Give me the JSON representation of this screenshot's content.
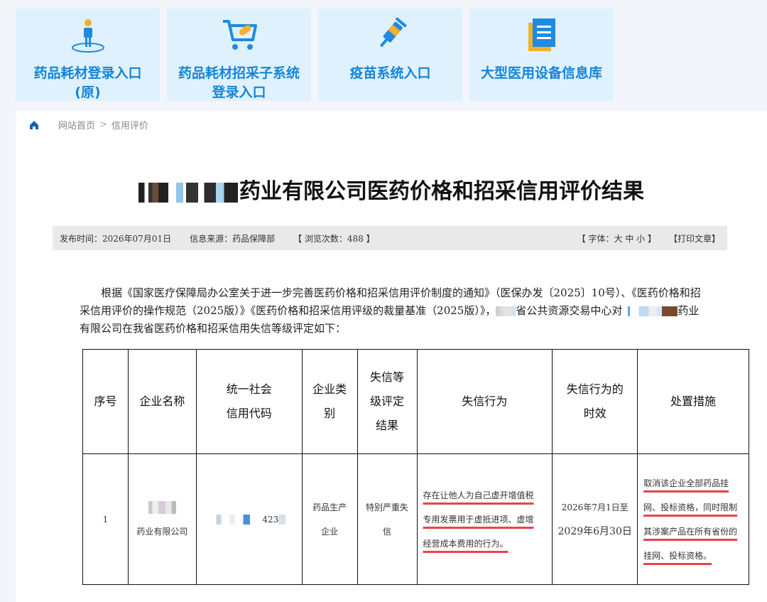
{
  "tiles": [
    {
      "label_line1": "药品耗材登录入口",
      "label_line2": "(原)",
      "icon": "person-pin-icon"
    },
    {
      "label_line1": "药品耗材招采子系统",
      "label_line2": "登录入口",
      "icon": "shopping-cart-pill-icon"
    },
    {
      "label_line1": "疫苗系统入口",
      "label_line2": "",
      "icon": "syringe-icon"
    },
    {
      "label_line1": "大型医用设备信息库",
      "label_line2": "",
      "icon": "document-list-icon"
    }
  ],
  "breadcrumb": {
    "home": "网站首页",
    "separator": ">",
    "current": "信用评价"
  },
  "article": {
    "title": "药业有限公司医药价格和招采信用评价结果",
    "meta": {
      "published": "发布时间：2026年07月01日",
      "source": "信息来源：药品保障部",
      "views": "【 浏览次数：488 】",
      "font_size": "【 字体：大 中 小 】",
      "print": "【打印文章】"
    },
    "para_part1": "根据《国家医疗保障局办公室关于进一步完善医药价格和招采信用评价制度的通知》（医保办发〔2025〕10号）、《医药价格和招采信用评价的操作规范（2025版）》《医药价格和招采信用评级的裁量基准（2025版）》，",
    "para_part2": "省公共资源交易中心对",
    "para_part3": "药业有限公司在我省医药价格和招采信用失信等级评定如下："
  },
  "table": {
    "headers": [
      "序号",
      "企业名称",
      "统一社会\n信用代码",
      "企业类\n别",
      "失信等\n级评定\n结果",
      "失信行为",
      "失信行为的\n时效",
      "处置措施"
    ],
    "row": {
      "index": "1",
      "company": "药业有限公司",
      "credit_code": "423",
      "category_line1": "药品生产",
      "category_line2": "企业",
      "rating_line1": "特别严重失",
      "rating_line2": "信",
      "behavior": [
        "存在让他人为自己虚开增值税",
        "专用发票用于虚抵进项、虚增",
        "经营成本费用的行为。"
      ],
      "period_line1": "2026年7月1日至",
      "period_line2": "2029年6月30日",
      "measures": [
        "取消该企业全部药品挂",
        "网、投标资格，同时限制",
        "其涉案产品在所有省份的",
        "挂网、投标资格。"
      ]
    }
  },
  "colors": {
    "accent": "#1585d8",
    "tile_bg": "#dff1fd",
    "underline": "#e8434a"
  }
}
